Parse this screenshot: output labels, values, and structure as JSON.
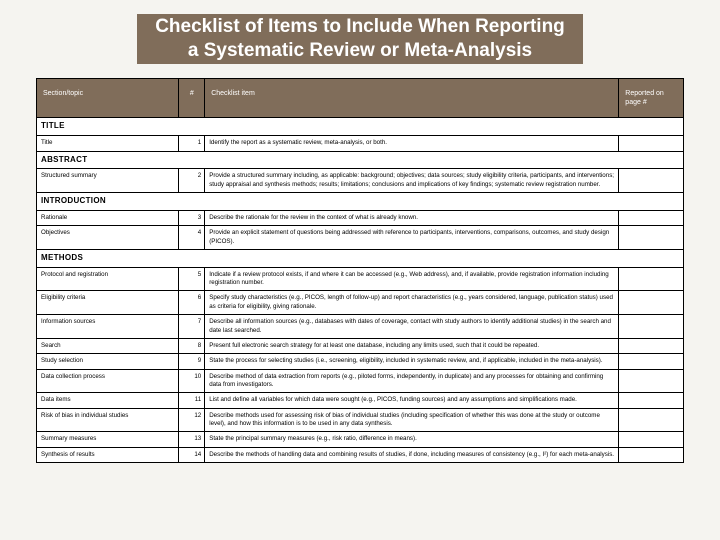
{
  "title_line1": "Checklist of Items to Include When Reporting",
  "title_line2": "a Systematic Review or Meta-Analysis",
  "headers": {
    "section": "Section/topic",
    "num": "#",
    "item": "Checklist item",
    "reported": "Reported on page #"
  },
  "sections": [
    {
      "name": "TITLE",
      "rows": [
        {
          "topic": "Title",
          "num": "1",
          "item": "Identify the report as a systematic review, meta-analysis, or both."
        }
      ]
    },
    {
      "name": "ABSTRACT",
      "rows": [
        {
          "topic": "Structured summary",
          "num": "2",
          "item": "Provide a structured summary including, as applicable: background; objectives; data sources; study eligibility criteria, participants, and interventions; study appraisal and synthesis methods; results; limitations; conclusions and implications of key findings; systematic review registration number."
        }
      ]
    },
    {
      "name": "INTRODUCTION",
      "rows": [
        {
          "topic": "Rationale",
          "num": "3",
          "item": "Describe the rationale for the review in the context of what is already known."
        },
        {
          "topic": "Objectives",
          "num": "4",
          "item": "Provide an explicit statement of questions being addressed with reference to participants, interventions, comparisons, outcomes, and study design (PICOS)."
        }
      ]
    },
    {
      "name": "METHODS",
      "rows": [
        {
          "topic": "Protocol and registration",
          "num": "5",
          "item": "Indicate if a review protocol exists, if and where it can be accessed (e.g., Web address), and, if available, provide registration information including registration number."
        },
        {
          "topic": "Eligibility criteria",
          "num": "6",
          "item": "Specify study characteristics (e.g., PICOS, length of follow-up) and report characteristics (e.g., years considered, language, publication status) used as criteria for eligibility, giving rationale."
        },
        {
          "topic": "Information sources",
          "num": "7",
          "item": "Describe all information sources (e.g., databases with dates of coverage, contact with study authors to identify additional studies) in the search and date last searched."
        },
        {
          "topic": "Search",
          "num": "8",
          "item": "Present full electronic search strategy for at least one database, including any limits used, such that it could be repeated."
        },
        {
          "topic": "Study selection",
          "num": "9",
          "item": "State the process for selecting studies (i.e., screening, eligibility, included in systematic review, and, if applicable, included in the meta-analysis)."
        },
        {
          "topic": "Data collection process",
          "num": "10",
          "item": "Describe method of data extraction from reports (e.g., piloted forms, independently, in duplicate) and any processes for obtaining and confirming data from investigators."
        },
        {
          "topic": "Data items",
          "num": "11",
          "item": "List and define all variables for which data were sought (e.g., PICOS, funding sources) and any assumptions and simplifications made."
        },
        {
          "topic": "Risk of bias in individual studies",
          "num": "12",
          "item": "Describe methods used for assessing risk of bias of individual studies (including specification of whether this was done at the study or outcome level), and how this information is to be used in any data synthesis."
        },
        {
          "topic": "Summary measures",
          "num": "13",
          "item": "State the principal summary measures (e.g., risk ratio, difference in means)."
        },
        {
          "topic": "Synthesis of results",
          "num": "14",
          "item": "Describe the methods of handling data and combining results of studies, if done, including measures of consistency (e.g., I²) for each meta-analysis."
        }
      ]
    }
  ]
}
